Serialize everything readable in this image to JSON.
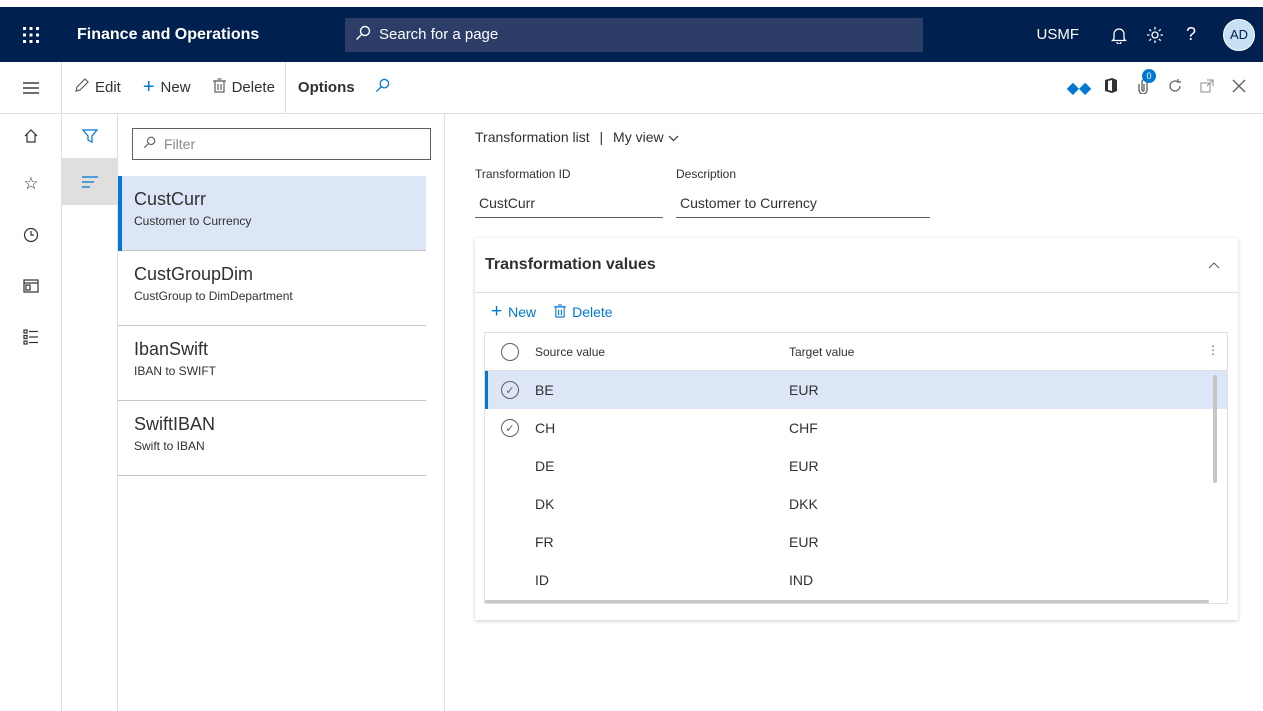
{
  "topbar": {
    "app_title": "Finance and Operations",
    "search_placeholder": "Search for a page",
    "company": "USMF",
    "avatar_initials": "AD"
  },
  "actionpane": {
    "edit": "Edit",
    "new": "New",
    "delete": "Delete",
    "options": "Options",
    "badge_count": "0"
  },
  "list": {
    "filter_placeholder": "Filter",
    "items": [
      {
        "title": "CustCurr",
        "subtitle": "Customer to Currency"
      },
      {
        "title": "CustGroupDim",
        "subtitle": "CustGroup to DimDepartment"
      },
      {
        "title": "IbanSwift",
        "subtitle": "IBAN to SWIFT"
      },
      {
        "title": "SwiftIBAN",
        "subtitle": "Swift to IBAN"
      }
    ]
  },
  "details": {
    "caption": "Transformation list",
    "separator": "|",
    "view": "My view",
    "id_label": "Transformation ID",
    "id_value": "CustCurr",
    "desc_label": "Description",
    "desc_value": "Customer to Currency",
    "fasttab_title": "Transformation values",
    "fasttab_new": "New",
    "fasttab_delete": "Delete",
    "grid": {
      "col_source": "Source value",
      "col_target": "Target value",
      "rows": [
        {
          "source": "BE",
          "target": "EUR"
        },
        {
          "source": "CH",
          "target": "CHF"
        },
        {
          "source": "DE",
          "target": "EUR"
        },
        {
          "source": "DK",
          "target": "DKK"
        },
        {
          "source": "FR",
          "target": "EUR"
        },
        {
          "source": "ID",
          "target": "IND"
        }
      ]
    }
  },
  "colors": {
    "nav_bar": "#002050",
    "accent": "#0078d4",
    "selection": "#dce6f7"
  }
}
